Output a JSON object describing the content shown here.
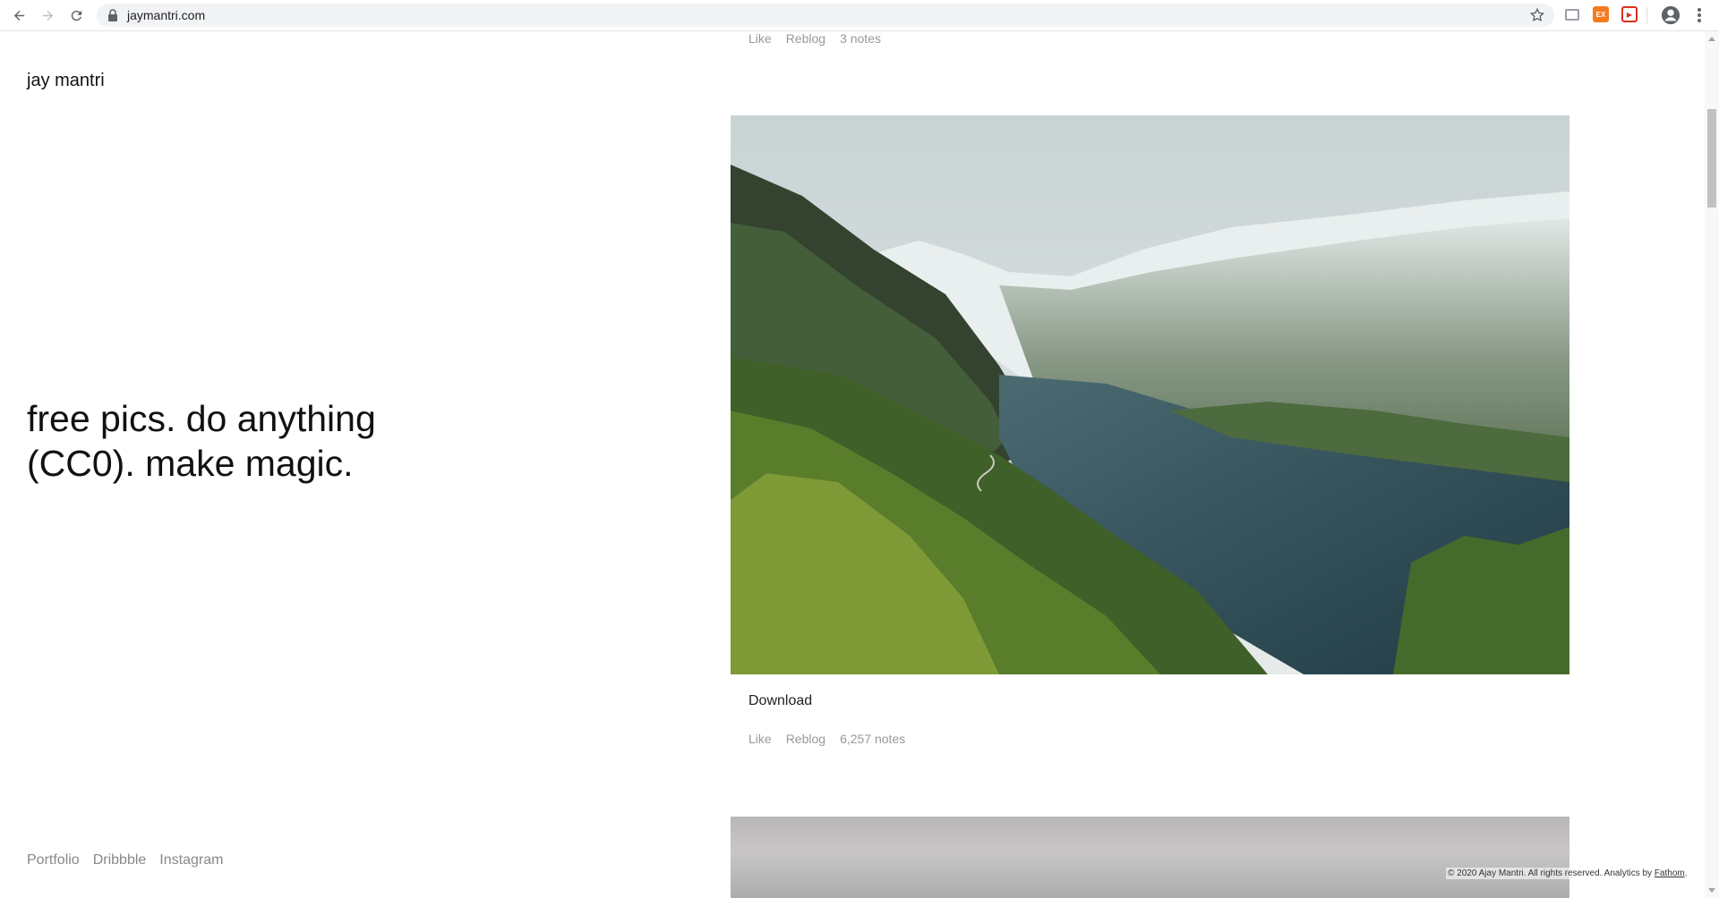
{
  "browser": {
    "url": "jaymantri.com",
    "extensions": [
      {
        "name": "cast-icon",
        "label": "",
        "color": "#9aa0a6"
      },
      {
        "name": "extension-orange-icon",
        "label": "EX",
        "color": "#f47b20"
      },
      {
        "name": "extension-red-icon",
        "label": "▶",
        "color": "#d93025"
      }
    ]
  },
  "site": {
    "title": "jay mantri",
    "tagline": "free pics. do anything (CC0). make magic."
  },
  "posts": [
    {
      "like": "Like",
      "reblog": "Reblog",
      "notes": "3 notes"
    },
    {
      "download": "Download",
      "like": "Like",
      "reblog": "Reblog",
      "notes": "6,257 notes"
    }
  ],
  "footer": {
    "links": [
      "Portfolio",
      "Dribbble",
      "Instagram"
    ],
    "copyright": "© 2020 Ajay Mantri. All rights reserved. Analytics by",
    "analytics_link": "Fathom",
    "analytics_suffix": "."
  }
}
